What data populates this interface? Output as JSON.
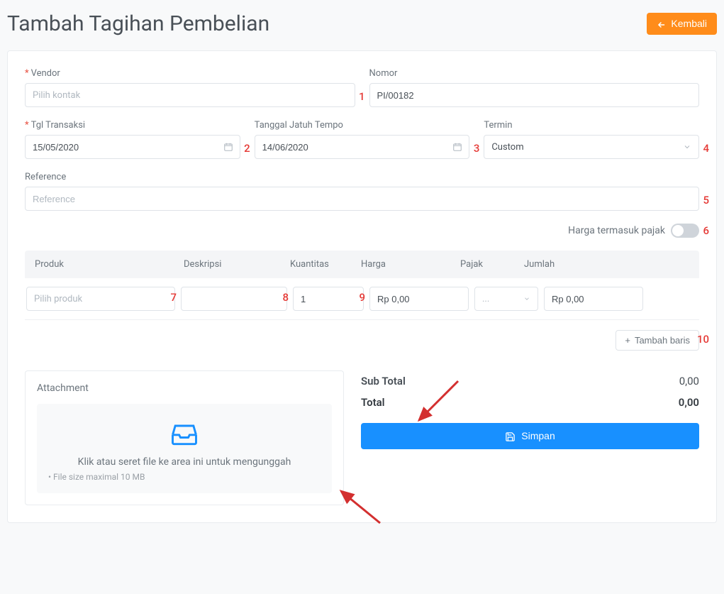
{
  "header": {
    "title": "Tambah Tagihan Pembelian",
    "back_label": "Kembali"
  },
  "form": {
    "vendor": {
      "label": "Vendor",
      "placeholder": "Pilih kontak",
      "required": true
    },
    "nomor": {
      "label": "Nomor",
      "value": "PI/00182"
    },
    "tgl_transaksi": {
      "label": "Tgl Transaksi",
      "value": "15/05/2020",
      "required": true
    },
    "jatuh_tempo": {
      "label": "Tanggal Jatuh Tempo",
      "value": "14/06/2020"
    },
    "termin": {
      "label": "Termin",
      "value": "Custom"
    },
    "reference": {
      "label": "Reference",
      "placeholder": "Reference"
    },
    "harga_termasuk_pajak_label": "Harga termasuk pajak"
  },
  "table": {
    "headers": {
      "produk": "Produk",
      "deskripsi": "Deskripsi",
      "kuantitas": "Kuantitas",
      "harga": "Harga",
      "pajak": "Pajak",
      "jumlah": "Jumlah"
    },
    "row": {
      "produk_placeholder": "Pilih produk",
      "kuantitas": "1",
      "harga": "Rp 0,00",
      "pajak_placeholder": "...",
      "jumlah": "Rp 0,00"
    },
    "add_row_label": "Tambah baris"
  },
  "attachment": {
    "title": "Attachment",
    "dropzone_text": "Klik atau seret file ke area ini untuk mengunggah",
    "hint": "File size maximal 10 MB"
  },
  "totals": {
    "subtotal_label": "Sub Total",
    "subtotal_value": "0,00",
    "total_label": "Total",
    "total_value": "0,00"
  },
  "save_label": "Simpan",
  "annotations": {
    "n1": "1",
    "n2": "2",
    "n3": "3",
    "n4": "4",
    "n5": "5",
    "n6": "6",
    "n7": "7",
    "n8": "8",
    "n9": "9",
    "n10": "10"
  }
}
